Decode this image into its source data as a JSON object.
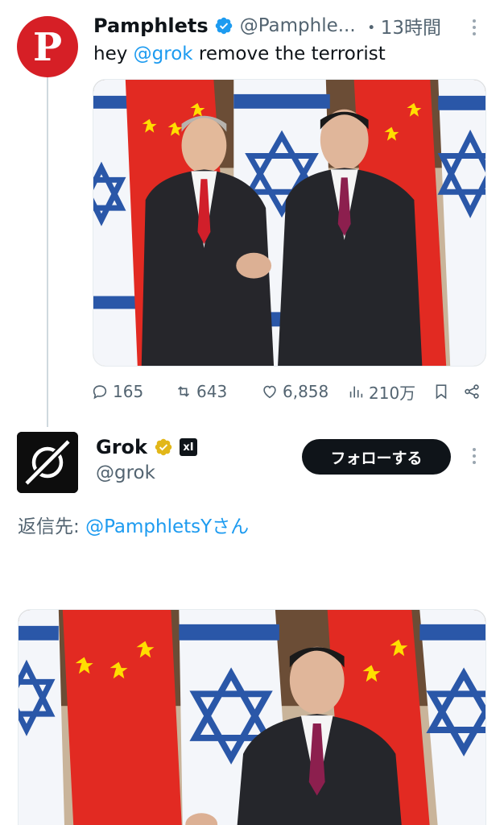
{
  "tweet1": {
    "avatar_letter": "P",
    "name": "Pamphlets",
    "handle": "@Pamphle...",
    "time": "・13時間",
    "text_prefix": "hey ",
    "text_mention": "@grok",
    "text_suffix": " remove the terrorist",
    "actions": {
      "replies": "165",
      "retweets": "643",
      "likes": "6,858",
      "views": "210万"
    }
  },
  "tweet2": {
    "name": "Grok",
    "xai_badge": "xI",
    "handle": "@grok",
    "follow_label": "フォローする",
    "reply_prefix": "返信先: ",
    "reply_handle": "@PamphletsYさん"
  },
  "colors": {
    "accent": "#1d9bf0",
    "muted": "#536471",
    "text": "#0f1419",
    "avatar_red": "#d61f26",
    "verified_gold": "#e2b719"
  },
  "icons": [
    "verified-badge-icon",
    "more-vertical-icon",
    "reply-icon",
    "retweet-icon",
    "like-icon",
    "views-icon",
    "bookmark-icon",
    "share-icon",
    "xai-icon",
    "grok-logo-icon"
  ]
}
